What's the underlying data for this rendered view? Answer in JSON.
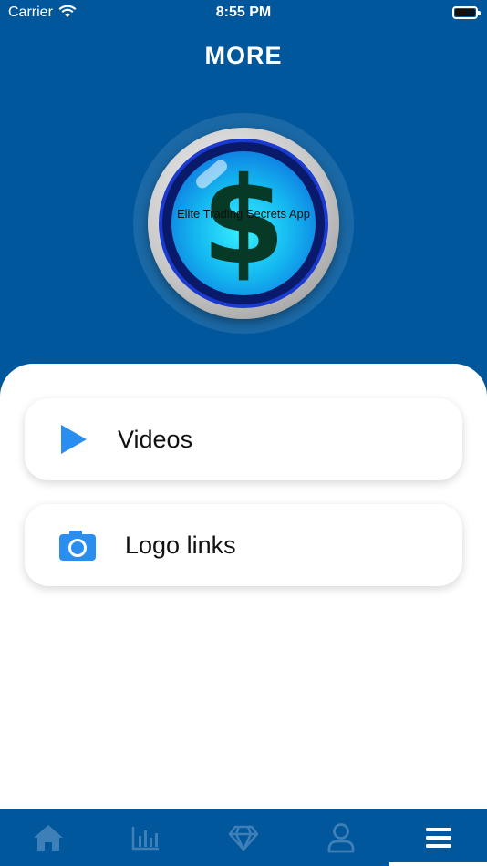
{
  "status_bar": {
    "carrier": "Carrier",
    "time": "8:55 PM"
  },
  "header": {
    "title": "MORE"
  },
  "logo": {
    "text": "Elite Trading Secrets App",
    "symbol": "$"
  },
  "menu": [
    {
      "label": "Videos",
      "icon": "play-icon"
    },
    {
      "label": "Logo links",
      "icon": "camera-icon"
    }
  ],
  "tab_bar": {
    "items": [
      {
        "icon": "home-icon",
        "active": false
      },
      {
        "icon": "bar-chart-icon",
        "active": false
      },
      {
        "icon": "diamond-icon",
        "active": false
      },
      {
        "icon": "user-icon",
        "active": false
      },
      {
        "icon": "menu-icon",
        "active": true
      }
    ]
  },
  "colors": {
    "primary": "#01579b",
    "accent": "#2a8ef0",
    "inactive_icon": "#3f7fb8",
    "active_icon": "#ffffff"
  }
}
